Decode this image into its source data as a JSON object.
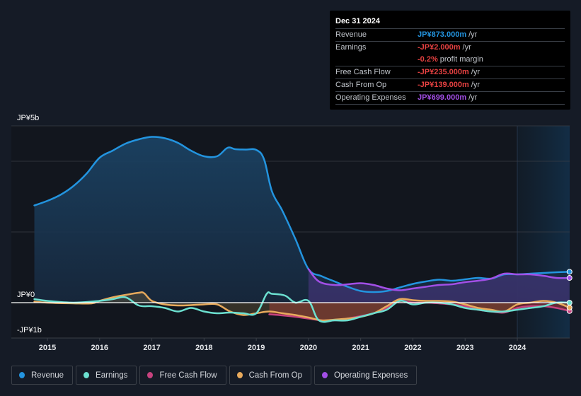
{
  "tooltip": {
    "date": "Dec 31 2024",
    "rows": [
      {
        "label": "Revenue",
        "value": "JP¥873.000m",
        "unit": "/yr",
        "color": "#2394df"
      },
      {
        "label": "Earnings",
        "value": "-JP¥2.000m",
        "unit": "/yr",
        "color": "#e64141"
      },
      {
        "label": "",
        "value": "-0.2%",
        "unit": "profit margin",
        "color": "#e64141"
      },
      {
        "label": "Free Cash Flow",
        "value": "-JP¥235.000m",
        "unit": "/yr",
        "color": "#e64141"
      },
      {
        "label": "Cash From Op",
        "value": "-JP¥139.000m",
        "unit": "/yr",
        "color": "#e64141"
      },
      {
        "label": "Operating Expenses",
        "value": "JP¥699.000m",
        "unit": "/yr",
        "color": "#a24fe6"
      }
    ]
  },
  "legend": [
    {
      "label": "Revenue",
      "color": "#2394df"
    },
    {
      "label": "Earnings",
      "color": "#6ce0d0"
    },
    {
      "label": "Free Cash Flow",
      "color": "#c6427e"
    },
    {
      "label": "Cash From Op",
      "color": "#e8aa5c"
    },
    {
      "label": "Operating Expenses",
      "color": "#a24fe6"
    }
  ],
  "chart_data": {
    "type": "line",
    "title": "",
    "xlabel": "",
    "ylabel": "",
    "ylim": [
      -1.0,
      5.0
    ],
    "xlim": [
      2014.2,
      2025.0
    ],
    "unit": "JP¥ billions",
    "y_tick_labels": [
      {
        "value": 5,
        "label": "JP¥5b"
      },
      {
        "value": 0,
        "label": "JP¥0"
      },
      {
        "value": -1,
        "label": "-JP¥1b"
      }
    ],
    "gridlines": [
      5,
      4,
      2,
      0,
      -1
    ],
    "x_tick_labels": [
      "2015",
      "2016",
      "2017",
      "2018",
      "2019",
      "2020",
      "2021",
      "2022",
      "2023",
      "2024"
    ],
    "x_ticks": [
      2015,
      2016,
      2017,
      2018,
      2019,
      2020,
      2021,
      2022,
      2023,
      2024
    ],
    "forecast_region_start": 2024.0,
    "series": [
      {
        "name": "Revenue",
        "color": "#2394df",
        "fill": true,
        "x": [
          2014.75,
          2015.0,
          2015.25,
          2015.5,
          2015.75,
          2016.0,
          2016.25,
          2016.5,
          2016.75,
          2017.0,
          2017.25,
          2017.5,
          2017.75,
          2018.0,
          2018.25,
          2018.45,
          2018.6,
          2018.8,
          2019.0,
          2019.15,
          2019.3,
          2019.5,
          2019.75,
          2020.0,
          2020.25,
          2020.5,
          2020.75,
          2021.0,
          2021.25,
          2021.5,
          2021.75,
          2022.0,
          2022.25,
          2022.5,
          2022.75,
          2023.0,
          2023.25,
          2023.5,
          2023.75,
          2024.0,
          2024.25,
          2024.5,
          2024.75,
          2025.0
        ],
        "values": [
          2.75,
          2.88,
          3.05,
          3.3,
          3.65,
          4.1,
          4.3,
          4.5,
          4.62,
          4.69,
          4.65,
          4.52,
          4.3,
          4.14,
          4.14,
          4.38,
          4.34,
          4.33,
          4.32,
          4.05,
          3.15,
          2.6,
          1.8,
          0.95,
          0.75,
          0.6,
          0.45,
          0.33,
          0.3,
          0.33,
          0.43,
          0.53,
          0.6,
          0.65,
          0.62,
          0.66,
          0.7,
          0.68,
          0.8,
          0.8,
          0.82,
          0.84,
          0.86,
          0.873
        ]
      },
      {
        "name": "Earnings",
        "color": "#6ce0d0",
        "fill": false,
        "x": [
          2014.75,
          2015.0,
          2015.5,
          2016.0,
          2016.25,
          2016.5,
          2016.75,
          2017.0,
          2017.25,
          2017.5,
          2017.75,
          2018.0,
          2018.25,
          2018.5,
          2018.75,
          2019.0,
          2019.2,
          2019.3,
          2019.55,
          2019.75,
          2020.0,
          2020.2,
          2020.5,
          2020.75,
          2021.0,
          2021.25,
          2021.5,
          2021.75,
          2022.0,
          2022.25,
          2022.5,
          2022.75,
          2023.0,
          2023.25,
          2023.5,
          2023.75,
          2024.0,
          2024.25,
          2024.5,
          2024.75,
          2025.0
        ],
        "values": [
          0.1,
          0.05,
          0.0,
          0.05,
          0.1,
          0.15,
          -0.08,
          -0.1,
          -0.15,
          -0.25,
          -0.15,
          -0.25,
          -0.3,
          -0.28,
          -0.3,
          -0.3,
          0.25,
          0.25,
          0.2,
          0.0,
          0.05,
          -0.5,
          -0.5,
          -0.5,
          -0.4,
          -0.3,
          -0.2,
          0.05,
          -0.05,
          0.0,
          0.0,
          -0.05,
          -0.15,
          -0.2,
          -0.25,
          -0.25,
          -0.2,
          -0.15,
          -0.1,
          0.0,
          -0.002
        ]
      },
      {
        "name": "Free Cash Flow",
        "color": "#c6427e",
        "fill": true,
        "x": [
          2019.25,
          2019.5,
          2019.75,
          2020.0,
          2020.25,
          2020.5,
          2020.75,
          2021.0,
          2021.25,
          2021.5,
          2021.75,
          2022.0,
          2022.25,
          2022.5,
          2022.75,
          2023.0,
          2023.25,
          2023.5,
          2023.75,
          2024.0,
          2024.25,
          2024.5,
          2024.75,
          2025.0
        ],
        "values": [
          -0.33,
          -0.36,
          -0.4,
          -0.45,
          -0.5,
          -0.5,
          -0.45,
          -0.38,
          -0.3,
          -0.15,
          0.05,
          0.0,
          0.0,
          -0.02,
          -0.05,
          -0.1,
          -0.2,
          -0.25,
          -0.28,
          -0.15,
          -0.1,
          -0.1,
          -0.15,
          -0.235
        ]
      },
      {
        "name": "Cash From Op",
        "color": "#e8aa5c",
        "fill": true,
        "x": [
          2014.75,
          2015.0,
          2015.5,
          2015.85,
          2016.0,
          2016.25,
          2016.5,
          2016.75,
          2016.85,
          2017.0,
          2017.25,
          2017.5,
          2017.75,
          2018.0,
          2018.25,
          2018.5,
          2018.75,
          2019.0,
          2019.25,
          2019.5,
          2019.75,
          2020.0,
          2020.25,
          2020.5,
          2020.75,
          2021.0,
          2021.25,
          2021.5,
          2021.75,
          2022.0,
          2022.25,
          2022.5,
          2022.75,
          2023.0,
          2023.25,
          2023.5,
          2023.75,
          2024.0,
          2024.25,
          2024.5,
          2024.75,
          2025.0
        ],
        "values": [
          0.03,
          0.0,
          -0.02,
          -0.02,
          0.05,
          0.15,
          0.22,
          0.28,
          0.27,
          0.05,
          -0.05,
          -0.08,
          -0.07,
          -0.05,
          -0.05,
          -0.25,
          -0.35,
          -0.3,
          -0.25,
          -0.3,
          -0.35,
          -0.42,
          -0.5,
          -0.48,
          -0.45,
          -0.4,
          -0.3,
          -0.1,
          0.1,
          0.07,
          0.05,
          0.05,
          0.03,
          -0.05,
          -0.15,
          -0.2,
          -0.25,
          -0.05,
          0.0,
          0.05,
          0.0,
          -0.139
        ]
      },
      {
        "name": "Operating Expenses",
        "color": "#a24fe6",
        "fill": true,
        "x": [
          2020.0,
          2020.2,
          2020.5,
          2020.75,
          2021.0,
          2021.25,
          2021.5,
          2021.75,
          2022.0,
          2022.25,
          2022.5,
          2022.75,
          2023.0,
          2023.25,
          2023.5,
          2023.75,
          2024.0,
          2024.25,
          2024.5,
          2024.75,
          2025.0
        ],
        "values": [
          0.95,
          0.6,
          0.5,
          0.52,
          0.55,
          0.5,
          0.4,
          0.35,
          0.4,
          0.45,
          0.5,
          0.52,
          0.58,
          0.62,
          0.68,
          0.82,
          0.8,
          0.8,
          0.76,
          0.7,
          0.699
        ]
      }
    ]
  }
}
